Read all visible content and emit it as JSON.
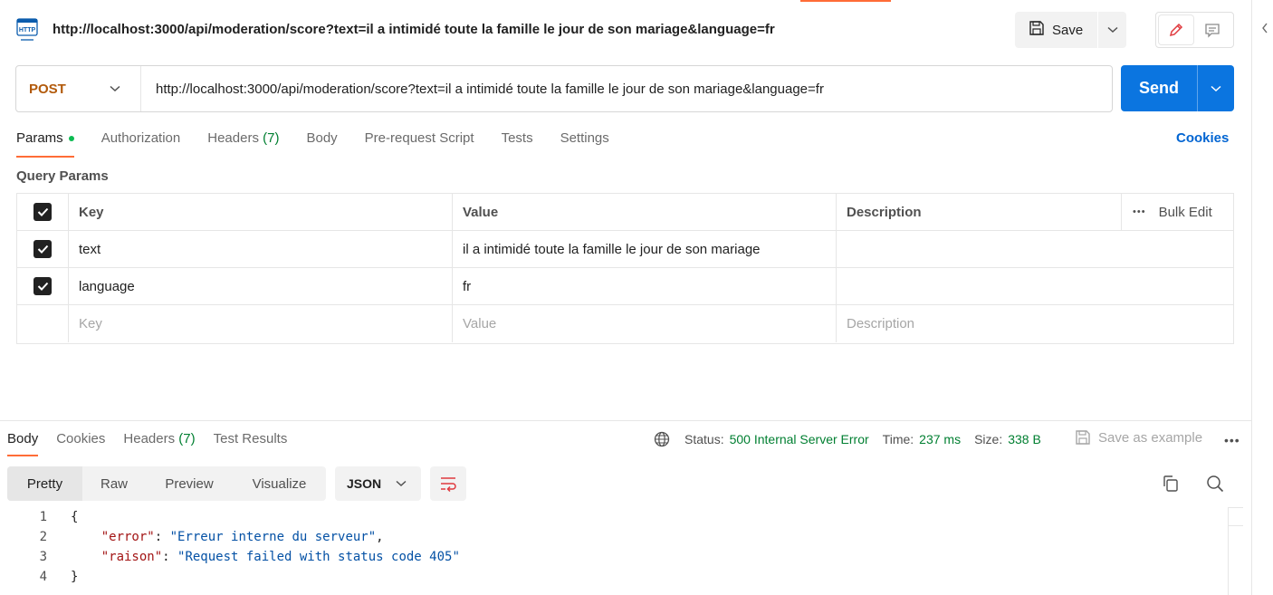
{
  "request": {
    "title": "http://localhost:3000/api/moderation/score?text=il a intimidé toute la famille le jour de son mariage&language=fr",
    "method": "POST",
    "url": "http://localhost:3000/api/moderation/score?text=il a intimidé toute la famille le jour de son mariage&language=fr",
    "icon_label": "HTTP"
  },
  "toolbar": {
    "save_label": "Save",
    "send_label": "Send"
  },
  "request_tabs": {
    "params": "Params",
    "authorization": "Authorization",
    "headers": "Headers",
    "headers_count": "(7)",
    "body": "Body",
    "pre_request": "Pre-request Script",
    "tests": "Tests",
    "settings": "Settings",
    "cookies": "Cookies"
  },
  "query_params": {
    "label": "Query Params",
    "headers": {
      "key": "Key",
      "value": "Value",
      "description": "Description",
      "bulk_edit": "Bulk Edit",
      "more": "•••"
    },
    "rows": [
      {
        "key": "text",
        "value": "il a intimidé toute la famille le jour de son mariage",
        "description": ""
      },
      {
        "key": "language",
        "value": "fr",
        "description": ""
      }
    ],
    "placeholders": {
      "key": "Key",
      "value": "Value",
      "description": "Description"
    }
  },
  "response": {
    "tabs": {
      "body": "Body",
      "cookies": "Cookies",
      "headers": "Headers",
      "headers_count": "(7)",
      "test_results": "Test Results"
    },
    "status_label": "Status:",
    "status_value": "500 Internal Server Error",
    "time_label": "Time:",
    "time_value": "237 ms",
    "size_label": "Size:",
    "size_value": "338 B",
    "save_example": "Save as example",
    "more": "•••",
    "views": {
      "pretty": "Pretty",
      "raw": "Raw",
      "preview": "Preview",
      "visualize": "Visualize"
    },
    "format": "JSON",
    "code_lines": [
      {
        "n": "1",
        "text": "{"
      },
      {
        "n": "2",
        "key": "\"error\"",
        "value": "\"Erreur interne du serveur\"",
        "suffix": ","
      },
      {
        "n": "3",
        "key": "\"raison\"",
        "value": "\"Request failed with status code 405\"",
        "suffix": ""
      },
      {
        "n": "4",
        "text": "}"
      }
    ]
  },
  "colors": {
    "accent": "#ff6c37",
    "send": "#0b75e0",
    "method_post": "#b25a0b",
    "status_ok": "#007f31",
    "link": "#0265d2"
  }
}
